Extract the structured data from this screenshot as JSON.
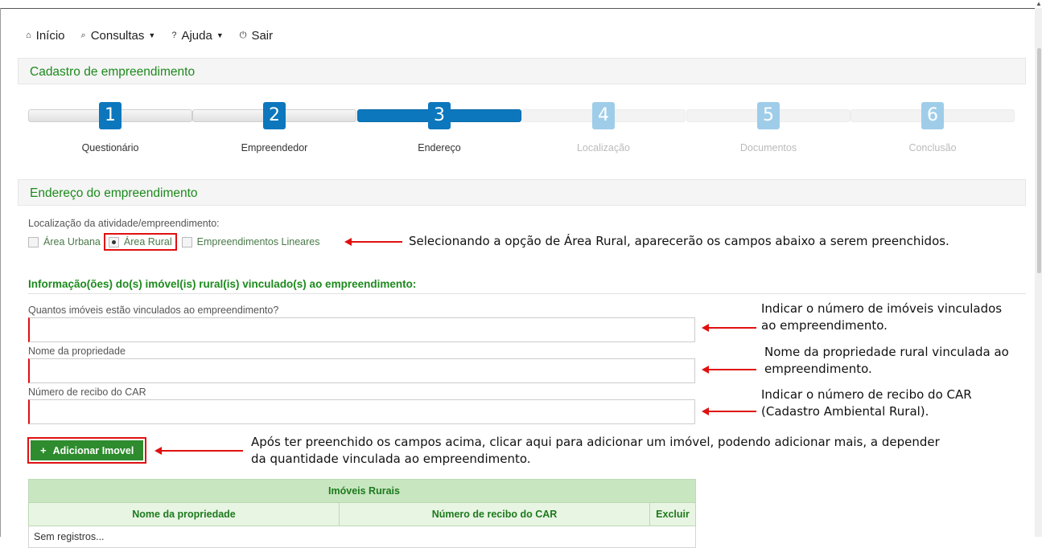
{
  "nav": {
    "items": [
      {
        "icon": "home-icon",
        "glyph": "⌂",
        "label": "Início"
      },
      {
        "icon": "search-icon",
        "glyph": "⌕",
        "label": "Consultas",
        "dropdown": true
      },
      {
        "icon": "question-icon",
        "glyph": "?",
        "label": "Ajuda",
        "dropdown": true
      },
      {
        "icon": "power-icon",
        "glyph": "⏻",
        "label": "Sair"
      }
    ]
  },
  "page": {
    "title": "Cadastro de empreendimento"
  },
  "wizard": {
    "steps": [
      {
        "num": "1",
        "label": "Questionário",
        "state": "done"
      },
      {
        "num": "2",
        "label": "Empreendedor",
        "state": "done"
      },
      {
        "num": "3",
        "label": "Endereço",
        "state": "active"
      },
      {
        "num": "4",
        "label": "Localização",
        "state": "todo"
      },
      {
        "num": "5",
        "label": "Documentos",
        "state": "todo"
      },
      {
        "num": "6",
        "label": "Conclusão",
        "state": "todo"
      }
    ]
  },
  "section": {
    "title": "Endereço do empreendimento",
    "location_label": "Localização da atividade/empreendimento:",
    "options": {
      "urbana": "Área Urbana",
      "rural": "Área Rural",
      "lineares": "Empreendimentos Lineares"
    }
  },
  "rural": {
    "title": "Informação(ões) do(s) imóvel(is) rural(is) vinculado(s) ao empreendimento:",
    "fields": {
      "quantity_label": "Quantos imóveis estão vinculados ao empreendimento?",
      "quantity_value": "",
      "property_label": "Nome da propriedade",
      "property_value": "",
      "car_label": "Número de recibo do CAR",
      "car_value": ""
    },
    "add_button": "Adicionar Imovel"
  },
  "table": {
    "caption": "Imóveis Rurais",
    "columns": [
      "Nome da propriedade",
      "Número de recibo do CAR",
      "Excluir"
    ],
    "empty_text": "Sem registros..."
  },
  "annotations": {
    "option": "Selecionando a opção de Área Rural, aparecerão os campos abaixo a serem preenchidos.",
    "quantity_1": "Indicar o número de imóveis vinculados",
    "quantity_2": "ao empreendimento.",
    "property_1": "Nome da propriedade rural vinculada ao",
    "property_2": "empreendimento.",
    "car_1": "Indicar o número de recibo do CAR",
    "car_2": "(Cadastro Ambiental Rural).",
    "button_1": "Após ter preenchido os campos acima, clicar aqui para adicionar um imóvel, podendo adicionar mais, a depender",
    "button_2": "da quantidade vinculada ao empreendimento."
  },
  "colors": {
    "accent_green": "#1d8a1d",
    "wizard_blue": "#0c77bd",
    "wizard_light": "#9fcde9",
    "highlight_red": "#e01010"
  }
}
